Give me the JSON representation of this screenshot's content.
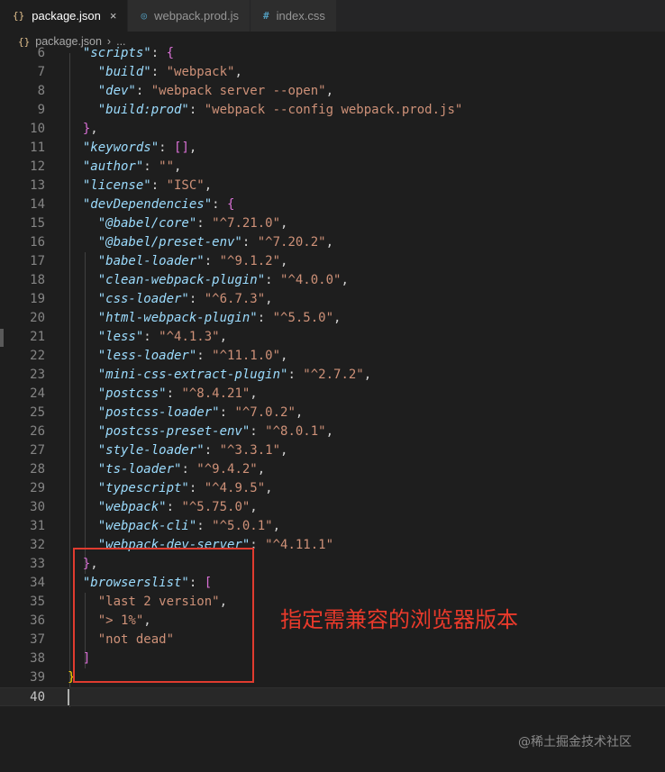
{
  "tabs": [
    {
      "icon": "{}",
      "icon_type": "json",
      "label": "package.json",
      "active": true,
      "close": "×"
    },
    {
      "icon": "◎",
      "icon_type": "js",
      "label": "webpack.prod.js",
      "active": false
    },
    {
      "icon": "#",
      "icon_type": "css",
      "label": "index.css",
      "active": false
    }
  ],
  "breadcrumb": {
    "icon": "{}",
    "file": "package.json",
    "separator": "›",
    "tail": "..."
  },
  "lines": [
    {
      "n": "6",
      "parts": [
        [
          "pun",
          "  "
        ],
        [
          "key",
          "\"scripts\""
        ],
        [
          "pun",
          ": "
        ],
        [
          "br1",
          "{"
        ]
      ]
    },
    {
      "n": "7",
      "parts": [
        [
          "pun",
          "    "
        ],
        [
          "key",
          "\"build\""
        ],
        [
          "pun",
          ": "
        ],
        [
          "str",
          "\"webpack\""
        ],
        [
          "pun",
          ","
        ]
      ]
    },
    {
      "n": "8",
      "parts": [
        [
          "pun",
          "    "
        ],
        [
          "key",
          "\"dev\""
        ],
        [
          "pun",
          ": "
        ],
        [
          "str",
          "\"webpack server --open\""
        ],
        [
          "pun",
          ","
        ]
      ]
    },
    {
      "n": "9",
      "parts": [
        [
          "pun",
          "    "
        ],
        [
          "key",
          "\"build:prod\""
        ],
        [
          "pun",
          ": "
        ],
        [
          "str",
          "\"webpack --config webpack.prod.js\""
        ]
      ]
    },
    {
      "n": "10",
      "parts": [
        [
          "pun",
          "  "
        ],
        [
          "br1",
          "}"
        ],
        [
          "pun",
          ","
        ]
      ]
    },
    {
      "n": "11",
      "parts": [
        [
          "pun",
          "  "
        ],
        [
          "key",
          "\"keywords\""
        ],
        [
          "pun",
          ": "
        ],
        [
          "br1",
          "[]"
        ],
        [
          "pun",
          ","
        ]
      ]
    },
    {
      "n": "12",
      "parts": [
        [
          "pun",
          "  "
        ],
        [
          "key",
          "\"author\""
        ],
        [
          "pun",
          ": "
        ],
        [
          "str",
          "\"\""
        ],
        [
          "pun",
          ","
        ]
      ]
    },
    {
      "n": "13",
      "parts": [
        [
          "pun",
          "  "
        ],
        [
          "key",
          "\"license\""
        ],
        [
          "pun",
          ": "
        ],
        [
          "str",
          "\"ISC\""
        ],
        [
          "pun",
          ","
        ]
      ]
    },
    {
      "n": "14",
      "parts": [
        [
          "pun",
          "  "
        ],
        [
          "key",
          "\"devDependencies\""
        ],
        [
          "pun",
          ": "
        ],
        [
          "br1",
          "{"
        ]
      ]
    },
    {
      "n": "15",
      "parts": [
        [
          "pun",
          "    "
        ],
        [
          "key",
          "\"@babel/core\""
        ],
        [
          "pun",
          ": "
        ],
        [
          "str",
          "\"^7.21.0\""
        ],
        [
          "pun",
          ","
        ]
      ]
    },
    {
      "n": "16",
      "parts": [
        [
          "pun",
          "    "
        ],
        [
          "key",
          "\"@babel/preset-env\""
        ],
        [
          "pun",
          ": "
        ],
        [
          "str",
          "\"^7.20.2\""
        ],
        [
          "pun",
          ","
        ]
      ]
    },
    {
      "n": "17",
      "parts": [
        [
          "pun",
          "    "
        ],
        [
          "key",
          "\"babel-loader\""
        ],
        [
          "pun",
          ": "
        ],
        [
          "str",
          "\"^9.1.2\""
        ],
        [
          "pun",
          ","
        ]
      ]
    },
    {
      "n": "18",
      "parts": [
        [
          "pun",
          "    "
        ],
        [
          "key",
          "\"clean-webpack-plugin\""
        ],
        [
          "pun",
          ": "
        ],
        [
          "str",
          "\"^4.0.0\""
        ],
        [
          "pun",
          ","
        ]
      ]
    },
    {
      "n": "19",
      "parts": [
        [
          "pun",
          "    "
        ],
        [
          "key",
          "\"css-loader\""
        ],
        [
          "pun",
          ": "
        ],
        [
          "str",
          "\"^6.7.3\""
        ],
        [
          "pun",
          ","
        ]
      ]
    },
    {
      "n": "20",
      "parts": [
        [
          "pun",
          "    "
        ],
        [
          "key",
          "\"html-webpack-plugin\""
        ],
        [
          "pun",
          ": "
        ],
        [
          "str",
          "\"^5.5.0\""
        ],
        [
          "pun",
          ","
        ]
      ]
    },
    {
      "n": "21",
      "parts": [
        [
          "pun",
          "    "
        ],
        [
          "key",
          "\"less\""
        ],
        [
          "pun",
          ": "
        ],
        [
          "str",
          "\"^4.1.3\""
        ],
        [
          "pun",
          ","
        ]
      ]
    },
    {
      "n": "22",
      "parts": [
        [
          "pun",
          "    "
        ],
        [
          "key",
          "\"less-loader\""
        ],
        [
          "pun",
          ": "
        ],
        [
          "str",
          "\"^11.1.0\""
        ],
        [
          "pun",
          ","
        ]
      ]
    },
    {
      "n": "23",
      "parts": [
        [
          "pun",
          "    "
        ],
        [
          "key",
          "\"mini-css-extract-plugin\""
        ],
        [
          "pun",
          ": "
        ],
        [
          "str",
          "\"^2.7.2\""
        ],
        [
          "pun",
          ","
        ]
      ]
    },
    {
      "n": "24",
      "parts": [
        [
          "pun",
          "    "
        ],
        [
          "key",
          "\"postcss\""
        ],
        [
          "pun",
          ": "
        ],
        [
          "str",
          "\"^8.4.21\""
        ],
        [
          "pun",
          ","
        ]
      ]
    },
    {
      "n": "25",
      "parts": [
        [
          "pun",
          "    "
        ],
        [
          "key",
          "\"postcss-loader\""
        ],
        [
          "pun",
          ": "
        ],
        [
          "str",
          "\"^7.0.2\""
        ],
        [
          "pun",
          ","
        ]
      ]
    },
    {
      "n": "26",
      "parts": [
        [
          "pun",
          "    "
        ],
        [
          "key",
          "\"postcss-preset-env\""
        ],
        [
          "pun",
          ": "
        ],
        [
          "str",
          "\"^8.0.1\""
        ],
        [
          "pun",
          ","
        ]
      ]
    },
    {
      "n": "27",
      "parts": [
        [
          "pun",
          "    "
        ],
        [
          "key",
          "\"style-loader\""
        ],
        [
          "pun",
          ": "
        ],
        [
          "str",
          "\"^3.3.1\""
        ],
        [
          "pun",
          ","
        ]
      ]
    },
    {
      "n": "28",
      "parts": [
        [
          "pun",
          "    "
        ],
        [
          "key",
          "\"ts-loader\""
        ],
        [
          "pun",
          ": "
        ],
        [
          "str",
          "\"^9.4.2\""
        ],
        [
          "pun",
          ","
        ]
      ]
    },
    {
      "n": "29",
      "parts": [
        [
          "pun",
          "    "
        ],
        [
          "key",
          "\"typescript\""
        ],
        [
          "pun",
          ": "
        ],
        [
          "str",
          "\"^4.9.5\""
        ],
        [
          "pun",
          ","
        ]
      ]
    },
    {
      "n": "30",
      "parts": [
        [
          "pun",
          "    "
        ],
        [
          "key",
          "\"webpack\""
        ],
        [
          "pun",
          ": "
        ],
        [
          "str",
          "\"^5.75.0\""
        ],
        [
          "pun",
          ","
        ]
      ]
    },
    {
      "n": "31",
      "parts": [
        [
          "pun",
          "    "
        ],
        [
          "key",
          "\"webpack-cli\""
        ],
        [
          "pun",
          ": "
        ],
        [
          "str",
          "\"^5.0.1\""
        ],
        [
          "pun",
          ","
        ]
      ]
    },
    {
      "n": "32",
      "parts": [
        [
          "pun",
          "    "
        ],
        [
          "key",
          "\"webpack-dev-server\""
        ],
        [
          "pun",
          ": "
        ],
        [
          "str",
          "\"^4.11.1\""
        ]
      ]
    },
    {
      "n": "33",
      "parts": [
        [
          "pun",
          "  "
        ],
        [
          "br1",
          "}"
        ],
        [
          "pun",
          ","
        ]
      ]
    },
    {
      "n": "34",
      "parts": [
        [
          "pun",
          "  "
        ],
        [
          "key",
          "\"browserslist\""
        ],
        [
          "pun",
          ": "
        ],
        [
          "br1",
          "["
        ]
      ]
    },
    {
      "n": "35",
      "parts": [
        [
          "pun",
          "    "
        ],
        [
          "str",
          "\"last 2 version\""
        ],
        [
          "pun",
          ","
        ]
      ]
    },
    {
      "n": "36",
      "parts": [
        [
          "pun",
          "    "
        ],
        [
          "str",
          "\"> 1%\""
        ],
        [
          "pun",
          ","
        ]
      ]
    },
    {
      "n": "37",
      "parts": [
        [
          "pun",
          "    "
        ],
        [
          "str",
          "\"not dead\""
        ]
      ]
    },
    {
      "n": "38",
      "parts": [
        [
          "pun",
          "  "
        ],
        [
          "br1",
          "]"
        ]
      ]
    },
    {
      "n": "39",
      "parts": [
        [
          "br0",
          "}"
        ]
      ]
    },
    {
      "n": "40",
      "parts": [],
      "current": true
    }
  ],
  "annotation": "指定需兼容的浏览器版本",
  "watermark": "@稀土掘金技术社区",
  "colors": {
    "accent_box": "#e03b2f",
    "key": "#9cdcfe",
    "string": "#ce9178"
  }
}
